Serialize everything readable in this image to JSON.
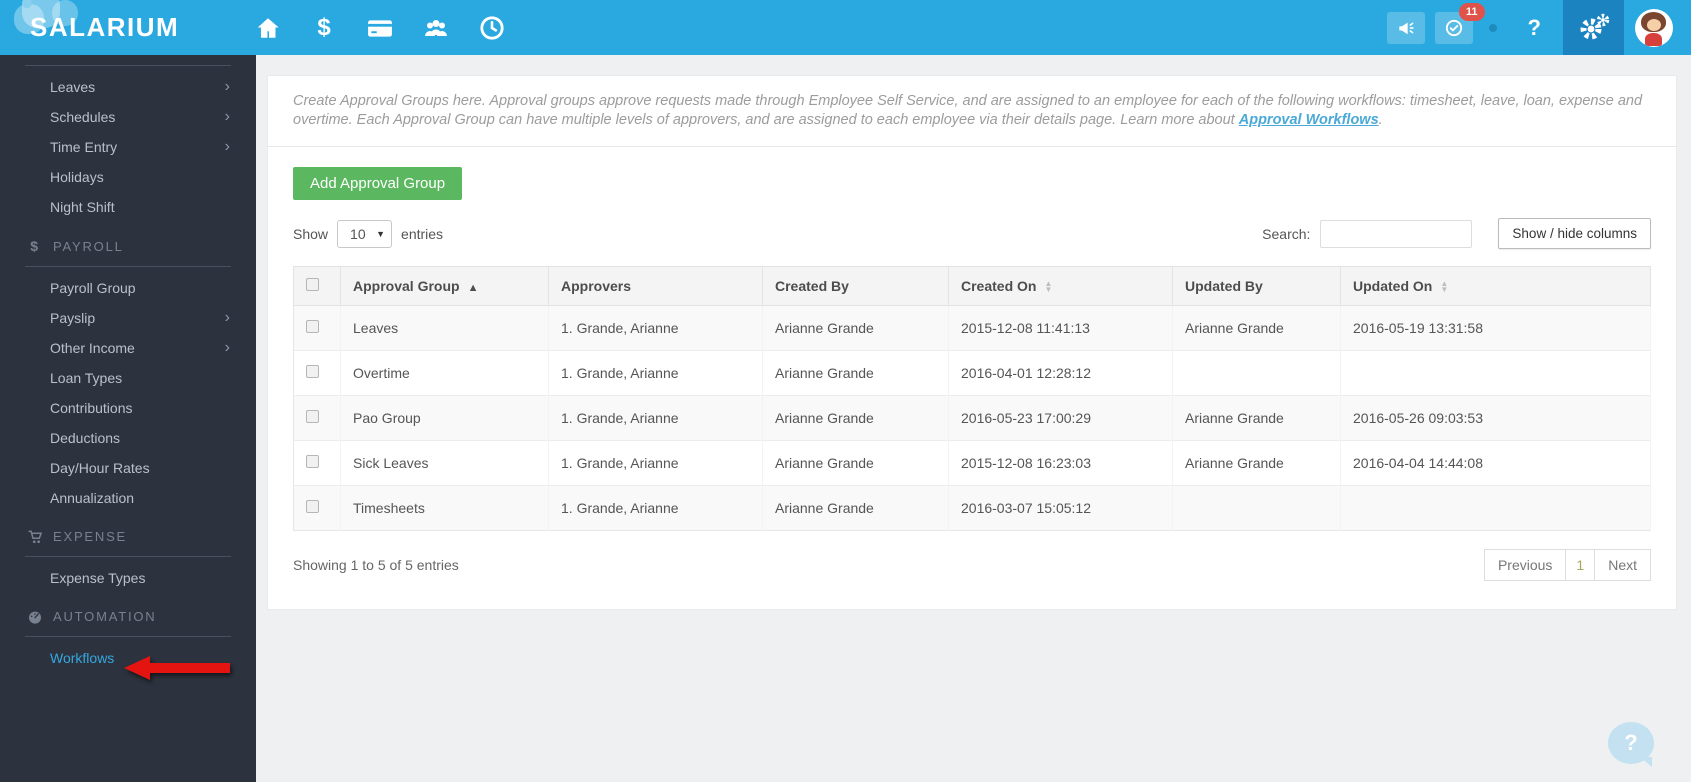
{
  "theme": {
    "topbar_blue": "#29a9e0",
    "gear_active_blue": "#1b84c0",
    "sidebar_dark": "#2d333e",
    "sidebar_link_blue": "#35a7e0",
    "accent_green": "#5cb860",
    "badge_red": "#e0534a",
    "arrow_red": "#e41410",
    "link_blue": "#4aa9d8"
  },
  "topbar": {
    "logo_text": "SALARIUM",
    "dollar_glyph": "$",
    "notifications_count": "11",
    "help_glyph": "?"
  },
  "sidebar": {
    "top_items": [
      {
        "label": "Leaves",
        "chevron": "›"
      },
      {
        "label": "Schedules",
        "chevron": "›"
      },
      {
        "label": "Time Entry",
        "chevron": "›"
      },
      {
        "label": "Holidays",
        "chevron": ""
      },
      {
        "label": "Night Shift",
        "chevron": ""
      }
    ],
    "sections": [
      {
        "label": "PAYROLL",
        "icon_glyph": "$",
        "items": [
          {
            "label": "Payroll Group",
            "chevron": ""
          },
          {
            "label": "Payslip",
            "chevron": "›"
          },
          {
            "label": "Other Income",
            "chevron": "›"
          },
          {
            "label": "Loan Types",
            "chevron": ""
          },
          {
            "label": "Contributions",
            "chevron": ""
          },
          {
            "label": "Deductions",
            "chevron": ""
          },
          {
            "label": "Day/Hour Rates",
            "chevron": ""
          },
          {
            "label": "Annualization",
            "chevron": ""
          }
        ]
      },
      {
        "label": "EXPENSE",
        "icon_glyph": "",
        "items": [
          {
            "label": "Expense Types",
            "chevron": ""
          }
        ]
      },
      {
        "label": "AUTOMATION",
        "icon_glyph": "",
        "items": [
          {
            "label": "Workflows",
            "chevron": ""
          }
        ]
      }
    ]
  },
  "content": {
    "intro": {
      "text": "Create Approval Groups here. Approval groups approve requests made through Employee Self Service, and are assigned to an employee for each of the following workflows: timesheet, leave, loan, expense and overtime. Each Approval Group can have multiple levels of approvers, and are assigned to each employee via their details page. Learn more about ",
      "link_text": "Approval Workflows",
      "suffix": "."
    },
    "add_button_label": "Add Approval Group",
    "show_label": "Show",
    "page_size": "10",
    "entries_label": "entries",
    "search_label": "Search:",
    "search_value": "",
    "columns_button_label": "Show / hide columns",
    "table": {
      "headers": [
        "Approval Group",
        "Approvers",
        "Created By",
        "Created On",
        "Updated By",
        "Updated On"
      ],
      "rows": [
        {
          "group": "Leaves",
          "approvers": "1. Grande, Arianne",
          "created_by": "Arianne Grande",
          "created_on": "2015-12-08 11:41:13",
          "updated_by": "Arianne Grande",
          "updated_on": "2016-05-19 13:31:58"
        },
        {
          "group": "Overtime",
          "approvers": "1. Grande, Arianne",
          "created_by": "Arianne Grande",
          "created_on": "2016-04-01 12:28:12",
          "updated_by": "",
          "updated_on": ""
        },
        {
          "group": "Pao Group",
          "approvers": "1. Grande, Arianne",
          "created_by": "Arianne Grande",
          "created_on": "2016-05-23 17:00:29",
          "updated_by": "Arianne Grande",
          "updated_on": "2016-05-26 09:03:53"
        },
        {
          "group": "Sick Leaves",
          "approvers": "1. Grande, Arianne",
          "created_by": "Arianne Grande",
          "created_on": "2015-12-08 16:23:03",
          "updated_by": "Arianne Grande",
          "updated_on": "2016-04-04 14:44:08"
        },
        {
          "group": "Timesheets",
          "approvers": "1. Grande, Arianne",
          "created_by": "Arianne Grande",
          "created_on": "2016-03-07 15:05:12",
          "updated_by": "",
          "updated_on": ""
        }
      ]
    },
    "footer": {
      "summary": "Showing 1 to 5 of 5 entries",
      "previous_label": "Previous",
      "current_page": "1",
      "next_label": "Next"
    }
  },
  "help_bubble_glyph": "?"
}
